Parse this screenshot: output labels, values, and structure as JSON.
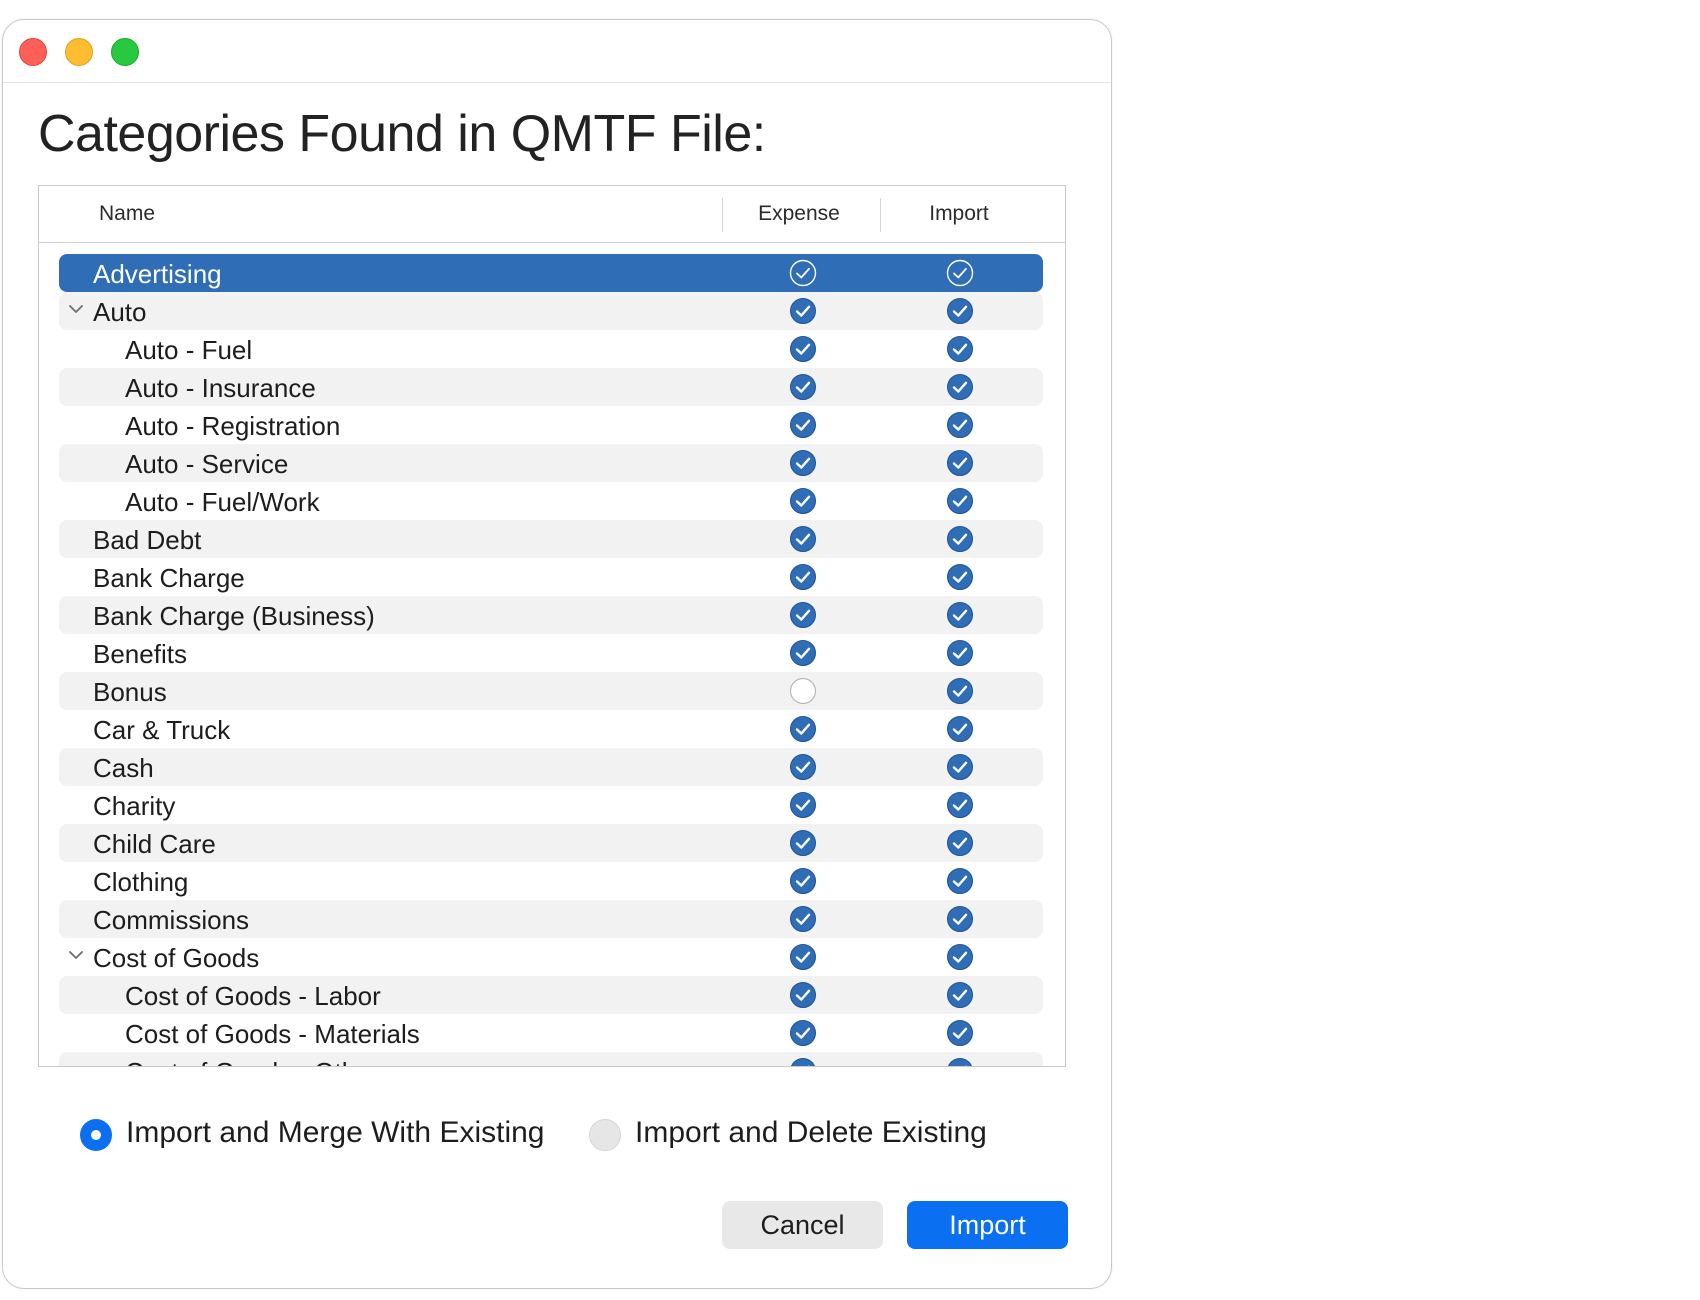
{
  "window": {
    "controls": [
      "close",
      "minimize",
      "maximize"
    ]
  },
  "heading": "Categories Found in QMTF File:",
  "table": {
    "columns": {
      "name": "Name",
      "expense": "Expense",
      "import": "Import"
    },
    "rows": [
      {
        "label": "Advertising",
        "level": 0,
        "expandable": false,
        "expense": true,
        "import": true,
        "selected": true
      },
      {
        "label": "Auto",
        "level": 0,
        "expandable": true,
        "expense": true,
        "import": true
      },
      {
        "label": "Auto - Fuel",
        "level": 1,
        "expandable": false,
        "expense": true,
        "import": true
      },
      {
        "label": "Auto - Insurance",
        "level": 1,
        "expandable": false,
        "expense": true,
        "import": true
      },
      {
        "label": "Auto - Registration",
        "level": 1,
        "expandable": false,
        "expense": true,
        "import": true
      },
      {
        "label": "Auto - Service",
        "level": 1,
        "expandable": false,
        "expense": true,
        "import": true
      },
      {
        "label": "Auto - Fuel/Work",
        "level": 1,
        "expandable": false,
        "expense": true,
        "import": true
      },
      {
        "label": "Bad Debt",
        "level": 0,
        "expandable": false,
        "expense": true,
        "import": true
      },
      {
        "label": "Bank Charge",
        "level": 0,
        "expandable": false,
        "expense": true,
        "import": true
      },
      {
        "label": "Bank Charge (Business)",
        "level": 0,
        "expandable": false,
        "expense": true,
        "import": true
      },
      {
        "label": "Benefits",
        "level": 0,
        "expandable": false,
        "expense": true,
        "import": true
      },
      {
        "label": "Bonus",
        "level": 0,
        "expandable": false,
        "expense": false,
        "import": true
      },
      {
        "label": "Car & Truck",
        "level": 0,
        "expandable": false,
        "expense": true,
        "import": true
      },
      {
        "label": "Cash",
        "level": 0,
        "expandable": false,
        "expense": true,
        "import": true
      },
      {
        "label": "Charity",
        "level": 0,
        "expandable": false,
        "expense": true,
        "import": true
      },
      {
        "label": "Child Care",
        "level": 0,
        "expandable": false,
        "expense": true,
        "import": true
      },
      {
        "label": "Clothing",
        "level": 0,
        "expandable": false,
        "expense": true,
        "import": true
      },
      {
        "label": "Commissions",
        "level": 0,
        "expandable": false,
        "expense": true,
        "import": true
      },
      {
        "label": "Cost of Goods",
        "level": 0,
        "expandable": true,
        "expense": true,
        "import": true
      },
      {
        "label": "Cost of Goods - Labor",
        "level": 1,
        "expandable": false,
        "expense": true,
        "import": true
      },
      {
        "label": "Cost of Goods - Materials",
        "level": 1,
        "expandable": false,
        "expense": true,
        "import": true
      },
      {
        "label": "Cost of Goods - Other",
        "level": 1,
        "expandable": false,
        "expense": true,
        "import": true
      }
    ]
  },
  "options": {
    "merge": {
      "label": "Import and Merge With Existing",
      "selected": true
    },
    "delete": {
      "label": "Import and Delete Existing",
      "selected": false
    }
  },
  "buttons": {
    "cancel": "Cancel",
    "import": "Import"
  },
  "colors": {
    "accent": "#0a6ff0",
    "selection": "#2f6db6",
    "check": "#2f6db6"
  }
}
